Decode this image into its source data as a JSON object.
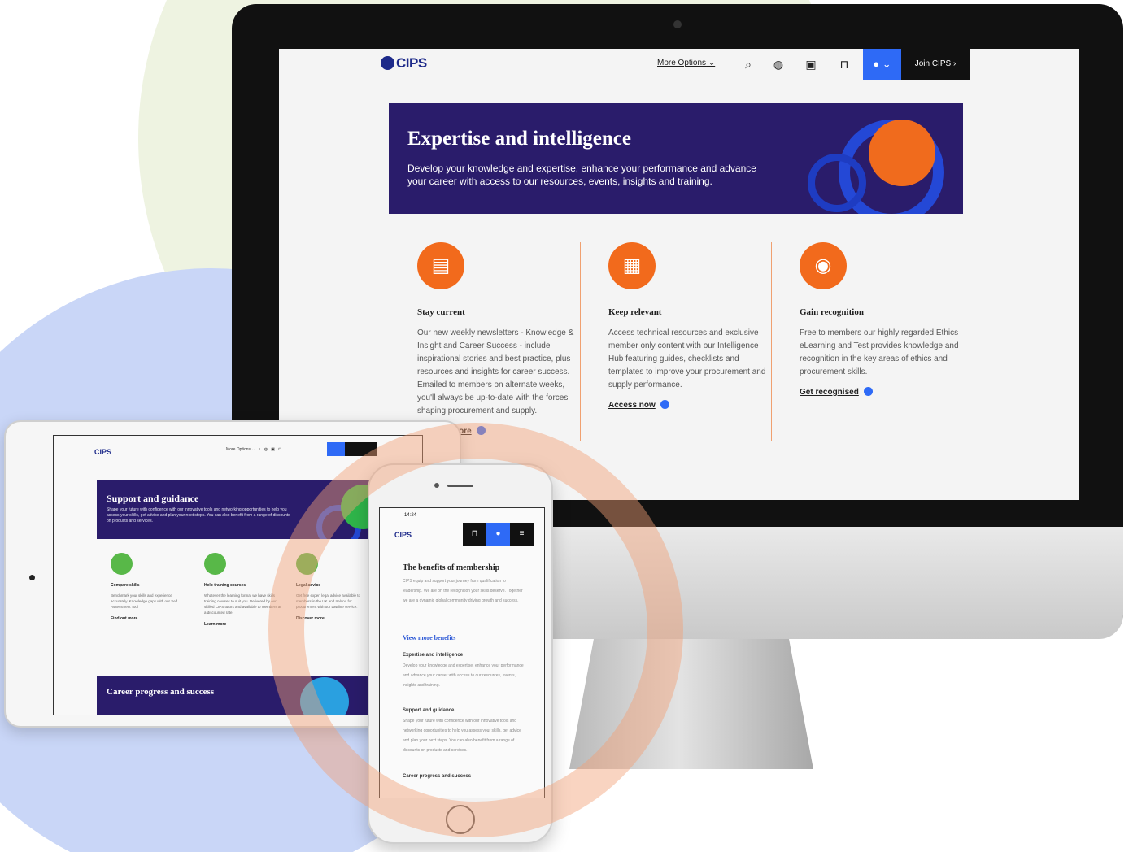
{
  "desktop": {
    "logo": "CIPS",
    "nav": {
      "more_options": "More Options",
      "join": "Join CIPS"
    },
    "hero": {
      "title": "Expertise and intelligence",
      "text": "Develop your knowledge and expertise, enhance your performance and advance your career with access to our resources, events, insights and training."
    },
    "columns": [
      {
        "title": "Stay current",
        "text": "Our new weekly newsletters - Knowledge & Insight and Career Success - include inspirational stories and best practice, plus resources and insights for career success. Emailed to members on alternate weeks, you'll always be up-to-date with the forces shaping procurement and supply.",
        "link": "Find out more"
      },
      {
        "title": "Keep relevant",
        "text": "Access technical resources and exclusive member only content with our Intelligence Hub featuring guides, checklists and templates to improve your procurement and supply performance.",
        "link": "Access now"
      },
      {
        "title": "Gain recognition",
        "text": "Free to members our highly regarded Ethics eLearning and Test provides knowledge and recognition in the key areas of ethics and procurement skills.",
        "link": "Get recognised"
      }
    ],
    "colors": {
      "hero_bg": "#2a1c6b",
      "accent_orange": "#f26a1c",
      "accent_blue": "#2e6af6"
    }
  },
  "tablet": {
    "logo": "CIPS",
    "hero_title": "Support and guidance",
    "hero_text": "Shape your future with confidence with our innovative tools and networking opportunities to help you assess your skills, get advice and plan your next steps. You can also benefit from a range of discounts on products and services.",
    "columns": [
      {
        "title": "Compare skills",
        "text": "Benchmark your skills and experience accurately. Knowledge gaps with our Self Assessment Tool",
        "link": "Find out more"
      },
      {
        "title": "Help training courses",
        "text": "Whatever the learning format we have skills training courses to suit you. Delivered by our skilled CIPS tutors and available to members at a discounted rate.",
        "link": "Learn more"
      },
      {
        "title": "Legal advice",
        "text": "Get free expert legal advice available to members in the UK and Ireland for procurement with our Lawline service.",
        "link": "Discover more"
      }
    ],
    "hero2_title": "Career progress and success"
  },
  "phone": {
    "time": "14:24",
    "logo": "CIPS",
    "title": "The benefits of membership",
    "intro": "CIPS equip and support your journey from qualification to leadership. We are on the recognition your skills deserve. Together we are a dynamic global community driving growth and success.",
    "link": "View more benefits",
    "sections": [
      {
        "title": "Expertise and intelligence",
        "text": "Develop your knowledge and expertise, enhance your performance and advance your career with access to our resources, events, insights and training."
      },
      {
        "title": "Support and guidance",
        "text": "Shape your future with confidence with our innovative tools and networking opportunities to help you assess your skills, get advice and plan your next steps. You can also benefit from a range of discounts on products and services."
      },
      {
        "title": "Career progress and success",
        "text": ""
      }
    ]
  }
}
